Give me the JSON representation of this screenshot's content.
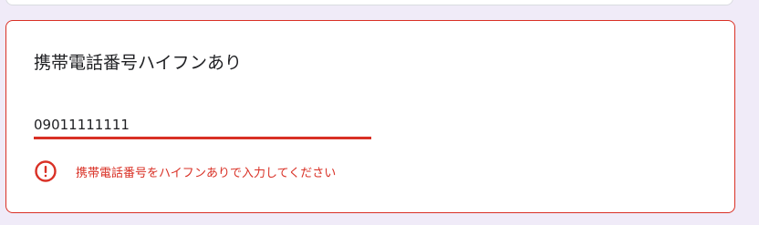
{
  "question": {
    "title": "携帯電話番号ハイフンあり",
    "answer_value": "09011111111",
    "error_message": "携帯電話番号をハイフンありで入力してください"
  },
  "colors": {
    "page_background": "#f0ebf8",
    "card_background": "#ffffff",
    "error_accent": "#d93025",
    "text_primary": "#202124"
  },
  "icons": {
    "error": "error-circle-exclamation-icon"
  }
}
